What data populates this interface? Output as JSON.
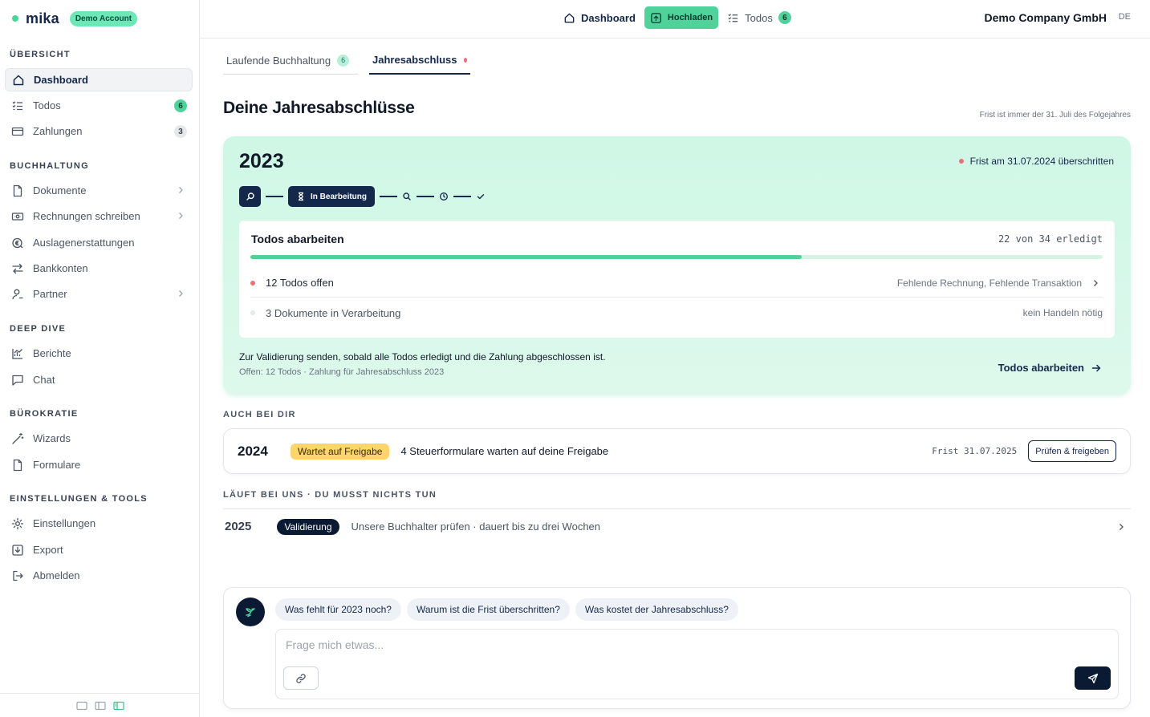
{
  "brand": {
    "name": "mika",
    "badge": "Demo Account"
  },
  "sidebar": {
    "sections": [
      {
        "label": "ÜBERSICHT"
      },
      {
        "label": "BUCHHALTUNG"
      },
      {
        "label": "DEEP DIVE"
      },
      {
        "label": "BÜROKRATIE"
      },
      {
        "label": "EINSTELLUNGEN & TOOLS"
      }
    ],
    "items": [
      {
        "label": "Dashboard",
        "icon": "home-icon",
        "active": true
      },
      {
        "label": "Todos",
        "icon": "checklist-icon",
        "count": "6"
      },
      {
        "label": "Zahlungen",
        "icon": "credit-card-icon",
        "count": "3"
      },
      {
        "label": "Dokumente",
        "icon": "document-icon"
      },
      {
        "label": "Rechnungen schreiben",
        "icon": "banknote-icon"
      },
      {
        "label": "Auslagenerstattungen",
        "icon": "receipt-icon"
      },
      {
        "label": "Bankkonten",
        "icon": "transfer-icon"
      },
      {
        "label": "Partner",
        "icon": "user-icon"
      },
      {
        "label": "Berichte",
        "icon": "chart-icon"
      },
      {
        "label": "Chat",
        "icon": "chat-icon"
      },
      {
        "label": "Wizards",
        "icon": "wand-icon"
      },
      {
        "label": "Formulare",
        "icon": "form-icon"
      },
      {
        "label": "Einstellungen",
        "icon": "settings-icon"
      },
      {
        "label": "Export",
        "icon": "export-icon"
      },
      {
        "label": "Abmelden",
        "icon": "logout-icon"
      }
    ]
  },
  "topbar": {
    "dashboard": "Dashboard",
    "upload": "Hochladen",
    "todos": "Todos",
    "todos_count": "6",
    "company": "Demo Company GmbH",
    "language": "DE"
  },
  "tabs": [
    {
      "label": "Laufende Buchhaltung",
      "count": "6"
    },
    {
      "label": "Jahresabschluss"
    }
  ],
  "page": {
    "title": "Deine Jahresabschlüsse",
    "deadline_note": "Frist ist immer der 31. Juli des Folgejahres"
  },
  "year_2023": {
    "year": "2023",
    "overdue": "Frist am 31.07.2024 überschritten",
    "current_step": "In Bearbeitung",
    "todo_panel": {
      "title": "Todos abarbeiten",
      "progress_text": "22 von 34 erledigt",
      "done": 22,
      "total": 34,
      "rows": [
        {
          "label": "12 Todos offen",
          "detail": "Fehlende Rechnung, Fehlende Transaktion"
        },
        {
          "label": "3 Dokumente in Verarbeitung",
          "detail": "kein Handeln nötig"
        }
      ]
    },
    "validate_message": "Zur Validierung senden, sobald alle Todos erledigt und die Zahlung abgeschlossen ist.",
    "validate_sub": "Offen: 12 Todos · Zahlung für Jahresabschluss 2023",
    "cta": "Todos abarbeiten"
  },
  "also_label": "AUCH BEI DIR",
  "year_2024": {
    "year": "2024",
    "status": "Wartet auf Freigabe",
    "message": "4 Steuerformulare warten auf deine Freigabe",
    "deadline": "Frist 31.07.2025",
    "action": "Prüfen & freigeben"
  },
  "running_label": "LÄUFT BEI UNS · DU MUSST NICHTS TUN",
  "year_2025": {
    "year": "2025",
    "status": "Validierung",
    "message": "Unsere Buchhalter prüfen · dauert bis zu drei Wochen"
  },
  "chat": {
    "suggestions": [
      "Was fehlt für 2023 noch?",
      "Warum ist die Frist überschritten?",
      "Was kostet der Jahresabschluss?"
    ],
    "placeholder": "Frage mich etwas...",
    "value": ""
  },
  "colors": {
    "brand_navy": "#14284b",
    "accent_green": "#4fd39b",
    "overdue_red": "#e5737a",
    "waiting_yellow": "#fcd66d"
  }
}
